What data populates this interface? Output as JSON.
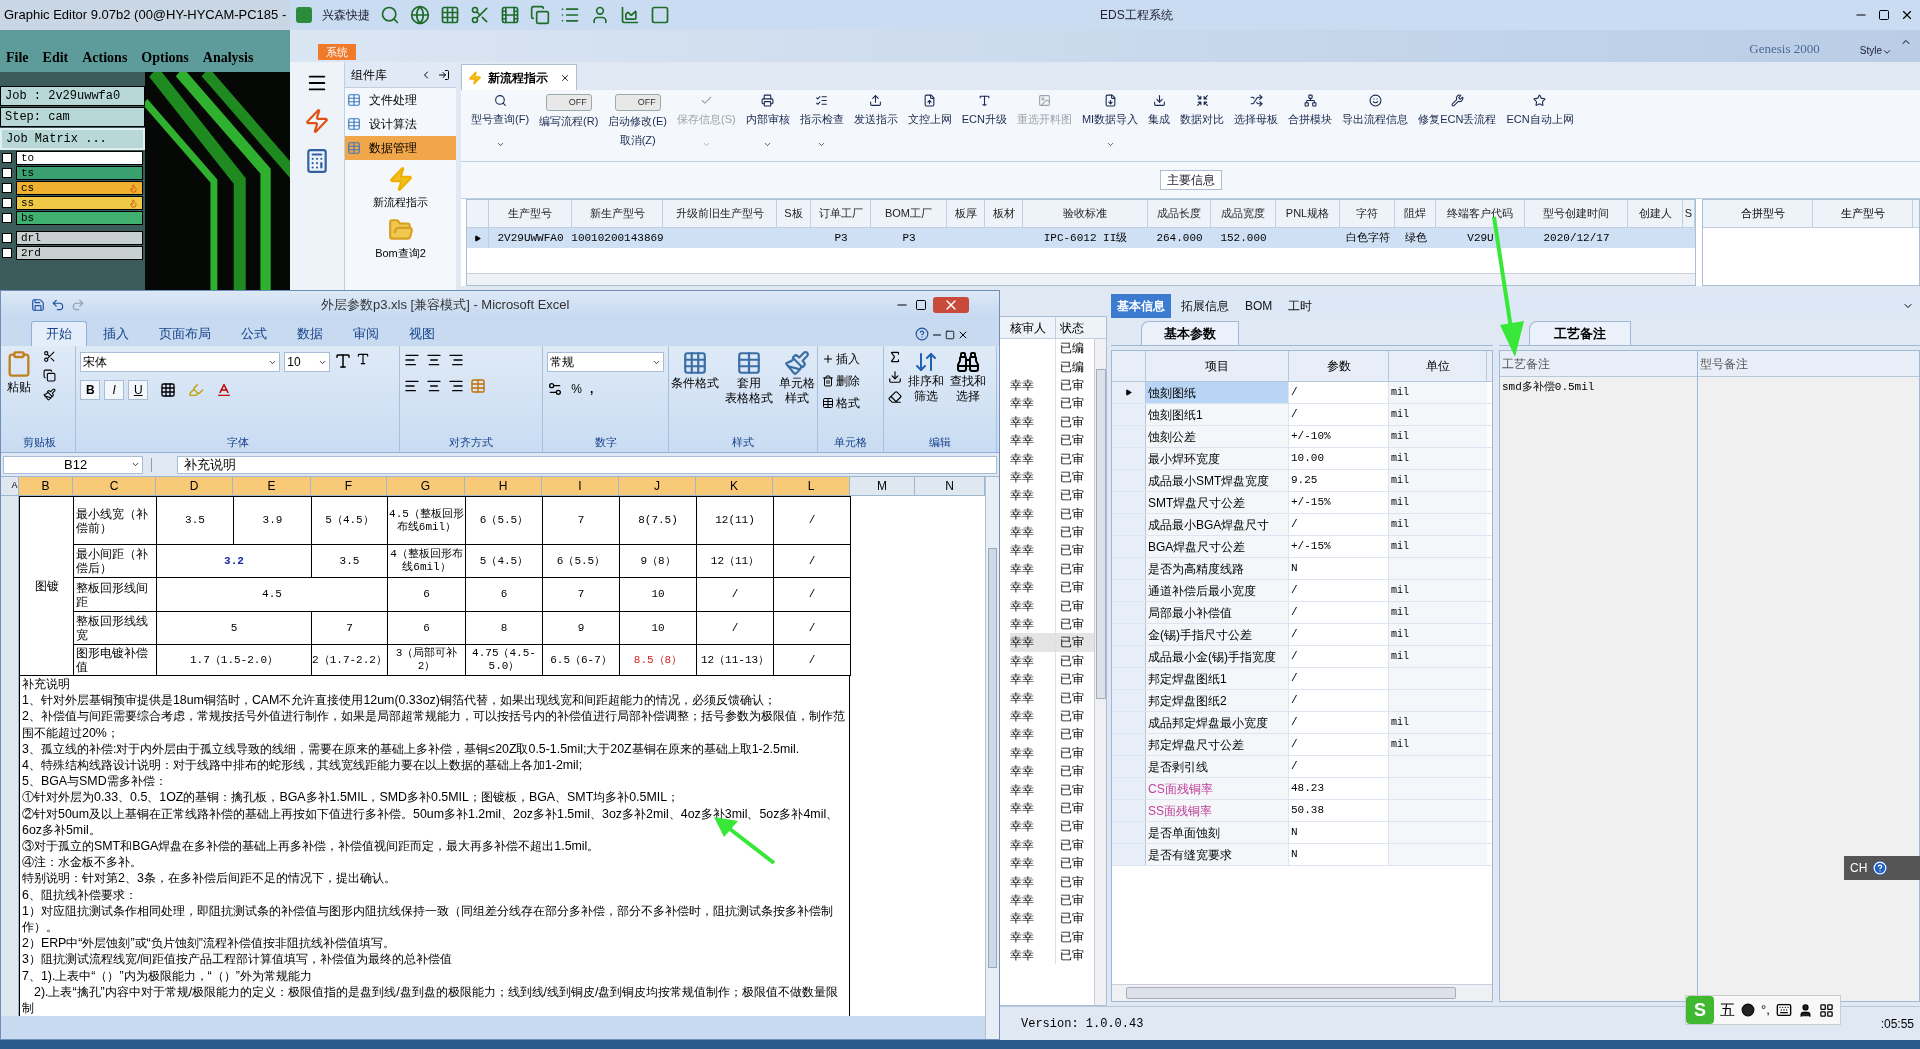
{
  "graphic_editor": {
    "title": "Graphic Editor 9.07b2 (00@HY-HYCAM-PC185 -",
    "menu": [
      "File",
      "Edit",
      "Actions",
      "Options",
      "Analysis"
    ],
    "job": "Job : 2v29uwwfa0",
    "step": "Step: cam",
    "job_matrix": "Job Matrix ...",
    "layers": [
      {
        "name": "to",
        "color": "#ffffff",
        "marked": false,
        "checked": false
      },
      {
        "name": "ts",
        "color": "#3aa070",
        "marked": false,
        "checked": false
      },
      {
        "name": "cs",
        "color": "#f0b030",
        "marked": true,
        "checked": false
      },
      {
        "name": "ss",
        "color": "#f0c848",
        "marked": true,
        "checked": false
      },
      {
        "name": "bs",
        "color": "#40b070",
        "marked": false,
        "checked": false
      },
      {
        "name": "drl",
        "color": "#c8d0d0",
        "marked": false,
        "checked": false
      },
      {
        "name": "2rd",
        "color": "#c8d0d0",
        "marked": false,
        "checked": false
      }
    ]
  },
  "eds": {
    "quick_launch": "兴森快捷",
    "title": "EDS工程系统",
    "system_tab": "系统",
    "banner_text": "Genesis 2000",
    "style_menu": "Style",
    "sidebar": {
      "title": "组件库",
      "categories": [
        {
          "label": "文件处理",
          "selected": false
        },
        {
          "label": "设计算法",
          "selected": false
        },
        {
          "label": "数据管理",
          "selected": true
        }
      ],
      "modules": [
        {
          "label": "新流程指示",
          "kind": "lightning"
        },
        {
          "label": "Bom查询2",
          "kind": "folder"
        }
      ]
    },
    "document_tab": "新流程指示",
    "toolbar": [
      {
        "kind": "button",
        "label": "型号查询(F)",
        "menu": true,
        "disabled": false
      },
      {
        "kind": "toggle",
        "label": "编写流程(R)",
        "switch_text": "OFF",
        "on": false
      },
      {
        "kind": "toggle",
        "label": "启动修改(E)",
        "switch_text": "OFF",
        "on": false,
        "sub_label": "取消(Z)"
      },
      {
        "kind": "button",
        "label": "保存信息(S)",
        "menu": true,
        "disabled": true
      },
      {
        "kind": "button",
        "label": "内部审核",
        "menu": true,
        "disabled": false
      },
      {
        "kind": "button",
        "label": "指示检查",
        "menu": true,
        "disabled": false
      },
      {
        "kind": "button",
        "label": "发送指示",
        "menu": false,
        "disabled": false
      },
      {
        "kind": "button",
        "label": "文控上网",
        "menu": false,
        "disabled": false
      },
      {
        "kind": "button",
        "label": "ECN升级",
        "menu": false,
        "disabled": false
      },
      {
        "kind": "button",
        "label": "重选开料图",
        "menu": false,
        "disabled": true
      },
      {
        "kind": "button",
        "label": "MI数据导入",
        "menu": true,
        "disabled": false
      },
      {
        "kind": "button",
        "label": "集成",
        "menu": false,
        "disabled": false
      },
      {
        "kind": "button",
        "label": "数据对比",
        "menu": false,
        "disabled": false
      },
      {
        "kind": "button",
        "label": "选择母板",
        "menu": false,
        "disabled": false
      },
      {
        "kind": "button",
        "label": "合拼模块",
        "menu": false,
        "disabled": false
      },
      {
        "kind": "button",
        "label": "导出流程信息",
        "menu": false,
        "disabled": false
      },
      {
        "kind": "button",
        "label": "修复ECN丢流程",
        "menu": false,
        "disabled": false
      },
      {
        "kind": "button",
        "label": "ECN自动上网",
        "menu": false,
        "disabled": false
      }
    ],
    "main_info_label": "主要信息",
    "main_table": {
      "columns": [
        "生产型号",
        "新生产型号",
        "升级前旧生产型号",
        "S板",
        "订单工厂",
        "BOM工厂",
        "板厚",
        "板材",
        "验收标准",
        "成品长度",
        "成品宽度",
        "PNL规格",
        "字符",
        "阻焊",
        "终端客户代码",
        "型号创建时间",
        "创建人",
        "S"
      ],
      "rows": [
        {
          "selected": true,
          "cells": [
            "2V29UWWFA0",
            "10010200143869",
            "",
            "",
            "P3",
            "P3",
            "",
            "",
            "IPC-6012 II级",
            "264.000",
            "152.000",
            "",
            "白色字符",
            "绿色",
            "V29U",
            "2020/12/17",
            "",
            ""
          ]
        }
      ]
    },
    "merge_table": {
      "columns": [
        "合拼型号",
        "生产型号"
      ]
    },
    "review_list": {
      "columns": [
        "核审人",
        "状态"
      ],
      "rows": [
        {
          "reviewer": "",
          "status": "已编",
          "selected": false
        },
        {
          "reviewer": "",
          "status": "已编",
          "selected": false
        },
        {
          "reviewer": "幸幸",
          "status": "已审",
          "selected": false
        },
        {
          "reviewer": "幸幸",
          "status": "已审",
          "selected": false
        },
        {
          "reviewer": "幸幸",
          "status": "已审",
          "selected": false
        },
        {
          "reviewer": "幸幸",
          "status": "已审",
          "selected": false
        },
        {
          "reviewer": "幸幸",
          "status": "已审",
          "selected": false
        },
        {
          "reviewer": "幸幸",
          "status": "已审",
          "selected": false
        },
        {
          "reviewer": "幸幸",
          "status": "已审",
          "selected": false
        },
        {
          "reviewer": "幸幸",
          "status": "已审",
          "selected": false
        },
        {
          "reviewer": "幸幸",
          "status": "已审",
          "selected": false
        },
        {
          "reviewer": "幸幸",
          "status": "已审",
          "selected": false
        },
        {
          "reviewer": "幸幸",
          "status": "已审",
          "selected": false
        },
        {
          "reviewer": "幸幸",
          "status": "已审",
          "selected": false
        },
        {
          "reviewer": "幸幸",
          "status": "已审",
          "selected": false
        },
        {
          "reviewer": "幸幸",
          "status": "已审",
          "selected": false
        },
        {
          "reviewer": "幸幸",
          "status": "已审",
          "selected": true
        },
        {
          "reviewer": "幸幸",
          "status": "已审",
          "selected": false
        },
        {
          "reviewer": "幸幸",
          "status": "已审",
          "selected": false
        },
        {
          "reviewer": "幸幸",
          "status": "已审",
          "selected": false
        },
        {
          "reviewer": "幸幸",
          "status": "已审",
          "selected": false
        },
        {
          "reviewer": "幸幸",
          "status": "已审",
          "selected": false
        },
        {
          "reviewer": "幸幸",
          "status": "已审",
          "selected": false
        },
        {
          "reviewer": "幸幸",
          "status": "已审",
          "selected": false
        },
        {
          "reviewer": "幸幸",
          "status": "已审",
          "selected": false
        },
        {
          "reviewer": "幸幸",
          "status": "已审",
          "selected": false
        },
        {
          "reviewer": "幸幸",
          "status": "已审",
          "selected": false
        },
        {
          "reviewer": "幸幸",
          "status": "已审",
          "selected": false
        },
        {
          "reviewer": "幸幸",
          "status": "已审",
          "selected": false
        },
        {
          "reviewer": "幸幸",
          "status": "已审",
          "selected": false
        },
        {
          "reviewer": "幸幸",
          "status": "已审",
          "selected": false
        },
        {
          "reviewer": "幸幸",
          "status": "已审",
          "selected": false
        },
        {
          "reviewer": "幸幸",
          "status": "已审",
          "selected": false
        },
        {
          "reviewer": "幸幸",
          "status": "已审",
          "selected": false
        }
      ]
    },
    "detail_tabs": [
      {
        "label": "基本信息",
        "selected": true
      },
      {
        "label": "拓展信息",
        "selected": false
      },
      {
        "label": "BOM",
        "selected": false
      },
      {
        "label": "工时",
        "selected": false
      }
    ],
    "params": {
      "tab": "基本参数",
      "columns": [
        "项目",
        "参数",
        "单位"
      ],
      "rows": [
        {
          "item": "蚀刻图纸",
          "value": "/",
          "unit": "mil",
          "selected": true,
          "flagged": false
        },
        {
          "item": "蚀刻图纸1",
          "value": "/",
          "unit": "mil",
          "selected": false,
          "flagged": false
        },
        {
          "item": "蚀刻公差",
          "value": "+/-10%",
          "unit": "mil",
          "selected": false,
          "flagged": false
        },
        {
          "item": "最小焊环宽度",
          "value": "10.00",
          "unit": "mil",
          "selected": false,
          "flagged": false
        },
        {
          "item": "成品最小SMT焊盘宽度",
          "value": "9.25",
          "unit": "mil",
          "selected": false,
          "flagged": false
        },
        {
          "item": "SMT焊盘尺寸公差",
          "value": "+/-15%",
          "unit": "mil",
          "selected": false,
          "flagged": false
        },
        {
          "item": "成品最小BGA焊盘尺寸",
          "value": "/",
          "unit": "mil",
          "selected": false,
          "flagged": false
        },
        {
          "item": "BGA焊盘尺寸公差",
          "value": "+/-15%",
          "unit": "mil",
          "selected": false,
          "flagged": false
        },
        {
          "item": "是否为高精度线路",
          "value": "N",
          "unit": "",
          "selected": false,
          "flagged": false
        },
        {
          "item": "通道补偿后最小宽度",
          "value": "/",
          "unit": "mil",
          "selected": false,
          "flagged": false
        },
        {
          "item": "局部最小补偿值",
          "value": "/",
          "unit": "mil",
          "selected": false,
          "flagged": false
        },
        {
          "item": "金(锡)手指尺寸公差",
          "value": "/",
          "unit": "mil",
          "selected": false,
          "flagged": false
        },
        {
          "item": "成品最小金(锡)手指宽度",
          "value": "/",
          "unit": "mil",
          "selected": false,
          "flagged": false
        },
        {
          "item": "邦定焊盘图纸1",
          "value": "/",
          "unit": "",
          "selected": false,
          "flagged": false
        },
        {
          "item": "邦定焊盘图纸2",
          "value": "/",
          "unit": "",
          "selected": false,
          "flagged": false
        },
        {
          "item": "成品邦定焊盘最小宽度",
          "value": "/",
          "unit": "mil",
          "selected": false,
          "flagged": false
        },
        {
          "item": "邦定焊盘尺寸公差",
          "value": "/",
          "unit": "mil",
          "selected": false,
          "flagged": false
        },
        {
          "item": "是否剥引线",
          "value": "/",
          "unit": "",
          "selected": false,
          "flagged": false
        },
        {
          "item": "CS面残铜率",
          "value": "48.23",
          "unit": "",
          "selected": false,
          "flagged": true
        },
        {
          "item": "SS面残铜率",
          "value": "50.38",
          "unit": "",
          "selected": false,
          "flagged": true
        },
        {
          "item": "是否单面蚀刻",
          "value": "N",
          "unit": "",
          "selected": false,
          "flagged": false
        },
        {
          "item": "是否有缝宽要求",
          "value": "N",
          "unit": "",
          "selected": false,
          "flagged": false
        }
      ]
    },
    "notes": {
      "tab": "工艺备注",
      "columns": [
        "工艺备注",
        "型号备注"
      ],
      "process_note": "smd多补偿0.5mil"
    },
    "status_bar": {
      "version": "Version: 1.0.0.43",
      "clock": ":05:55"
    }
  },
  "ime_bar": {
    "logo": "S",
    "mode": "五",
    "punctuation": "°,"
  },
  "language_bar": {
    "label": "CH"
  },
  "excel": {
    "title": "外层参数p3.xls  [兼容模式] - Microsoft Excel",
    "tabs": [
      {
        "label": "开始",
        "selected": true
      },
      {
        "label": "插入",
        "selected": false
      },
      {
        "label": "页面布局",
        "selected": false
      },
      {
        "label": "公式",
        "selected": false
      },
      {
        "label": "数据",
        "selected": false
      },
      {
        "label": "审阅",
        "selected": false
      },
      {
        "label": "视图",
        "selected": false
      }
    ],
    "ribbon": {
      "paste": "粘贴",
      "clipboard": "剪贴板",
      "font_name": "宋体",
      "font_size": "10",
      "font_buttons": [
        "B",
        "I",
        "U"
      ],
      "font_group": "字体",
      "align_group": "对齐方式",
      "number_format": "常规",
      "percent": "%",
      "comma": ",",
      "number_group": "数字",
      "conditional_format": [
        "条件格式"
      ],
      "table_format": [
        "套用",
        "表格格式"
      ],
      "cell_style": [
        "单元格",
        "样式"
      ],
      "styles_group": "样式",
      "insert": "插入",
      "delete": "删除",
      "format": "格式",
      "cells_group": "单元格",
      "sort_filter": [
        "排序和",
        "筛选"
      ],
      "find_select": [
        "查找和",
        "选择"
      ],
      "editing_group": "编辑"
    },
    "name_box": "B12",
    "formula": "补充说明",
    "column_letters": [
      "A",
      "B",
      "C",
      "D",
      "E",
      "F",
      "G",
      "H",
      "I",
      "J",
      "K",
      "L",
      "M",
      "N"
    ],
    "group_label": "图镀",
    "rows": [
      {
        "label": "最小线宽（补偿前）",
        "cells": [
          {
            "text": "3.5",
            "kind": "normal"
          },
          {
            "text": "3.9",
            "kind": "normal"
          },
          {
            "text": "5（4.5）",
            "kind": "normal"
          },
          {
            "text": "4.5（整板回形布线6mil）",
            "kind": "normal"
          },
          {
            "text": "6（5.5）",
            "kind": "normal"
          },
          {
            "text": "7",
            "kind": "normal"
          },
          {
            "text": "8(7.5)",
            "kind": "normal"
          },
          {
            "text": "12(11)",
            "kind": "normal"
          },
          {
            "text": "/",
            "kind": "normal"
          }
        ]
      },
      {
        "label": "最小间距（补偿后）",
        "cells": [
          {
            "text": "3.2",
            "kind": "blue"
          },
          {
            "kind": "merged"
          },
          {
            "text": "3.5",
            "kind": "normal"
          },
          {
            "text": "4（整板回形布线6mil）",
            "kind": "normal"
          },
          {
            "text": "5（4.5）",
            "kind": "normal"
          },
          {
            "text": "6（5.5）",
            "kind": "normal"
          },
          {
            "text": "9（8）",
            "kind": "normal"
          },
          {
            "text": "12（11）",
            "kind": "normal"
          },
          {
            "text": "/",
            "kind": "normal"
          }
        ]
      },
      {
        "label": "整板回形线间距",
        "cells": [
          {
            "text": "4.5",
            "kind": "normal"
          },
          {
            "kind": "merged"
          },
          {
            "kind": "merged"
          },
          {
            "text": "6",
            "kind": "normal"
          },
          {
            "text": "6",
            "kind": "normal"
          },
          {
            "text": "7",
            "kind": "normal"
          },
          {
            "text": "10",
            "kind": "normal"
          },
          {
            "text": "/",
            "kind": "normal"
          },
          {
            "text": "/",
            "kind": "normal"
          }
        ]
      },
      {
        "label": "整板回形线线宽",
        "cells": [
          {
            "text": "5",
            "kind": "normal"
          },
          {
            "kind": "merged"
          },
          {
            "text": "7",
            "kind": "normal"
          },
          {
            "text": "6",
            "kind": "normal"
          },
          {
            "text": "8",
            "kind": "normal"
          },
          {
            "text": "9",
            "kind": "normal"
          },
          {
            "text": "10",
            "kind": "normal"
          },
          {
            "text": "/",
            "kind": "normal"
          },
          {
            "text": "/",
            "kind": "normal"
          }
        ]
      },
      {
        "label": "图形电镀补偿值",
        "cells": [
          {
            "text": "1.7（1.5-2.0）",
            "kind": "normal"
          },
          {
            "kind": "merged"
          },
          {
            "text": "2（1.7-2.2）",
            "kind": "normal"
          },
          {
            "text": "3（局部可补2）",
            "kind": "normal"
          },
          {
            "text": "4.75（4.5-5.0）",
            "kind": "normal"
          },
          {
            "text": "6.5（6-7）",
            "kind": "normal"
          },
          {
            "text": "8.5（8）",
            "kind": "red"
          },
          {
            "text": "12（11-13）",
            "kind": "normal"
          },
          {
            "text": "/",
            "kind": "normal"
          }
        ]
      }
    ],
    "notes": [
      "补充说明",
      "1、针对外层基铜预审提供是18um铜箔时，CAM不允许直接使用12um(0.33oz)铜箔代替，如果出现线宽和间距超能力的情况，必须反馈确认；",
      "2、补偿值与间距需要综合考虑，常规按括号外值进行制作，如果是局部超常规能力，可以按括号内的补偿值进行局部补偿调整；括号参数为极限值，制作范围不能超过20%；",
      "3、孤立线的补偿:对于内外层由于孤立线导致的线细，需要在原来的基础上多补偿，基铜≤20Z取0.5-1.5mil;大于20Z基铜在原来的基础上取1-2.5mil.",
      "4、特殊结构线路设计说明：对于线路中排布的蛇形线，其线宽线距能力要在以上数据的基础上各加1-2mil;",
      "5、BGA与SMD需多补偿：",
      "①针对外层为0.33、0.5、1OZ的基铜：擒孔板，BGA多补1.5MIL，SMD多补0.5MIL；图镀板，BGA、SMT均多补0.5MIL；",
      "②针对50um及以上基铜在正常线路补偿的基础上再按如下值进行多补偿。50um多补1.2mil、2oz多补1.5mil、3oz多补2mil、4oz多补3mil、5oz多补4mil、6oz多补5mil。",
      "③对于孤立的SMT和BGA焊盘在多补偿的基础上再多补偿，补偿值视间距而定，最大再多补偿不超出1.5mil。",
      "④注：水金板不多补。",
      "特别说明：针对第2、3条，在多补偿后间距不足的情况下，提出确认。",
      "6、阻抗线补偿要求：",
      "1）对应阻抗测试条作相同处理，即阻抗测试条的补偿值与图形内阻抗线保持一致（同组差分线存在部分多补偿，部分不多补偿时，阻抗测试条按多补偿制作）。",
      "2）ERP中“外层蚀刻”或“负片蚀刻”流程补偿值按非阻抗线补偿值填写。",
      "3）阻抗测试流程线宽/间距值按产品工程部计算值填写，补偿值为最终的总补偿值",
      "7、1).上表中“（）”内为极限能力，“（）”外为常规能力",
      "　2).上表“擒孔”内容中对于常规/极限能力的定义：极限值指的是盘到线/盘到盘的极限能力；线到线/线到铜皮/盘到铜皮均按常规值制作；极限值不做数量限制"
    ]
  }
}
